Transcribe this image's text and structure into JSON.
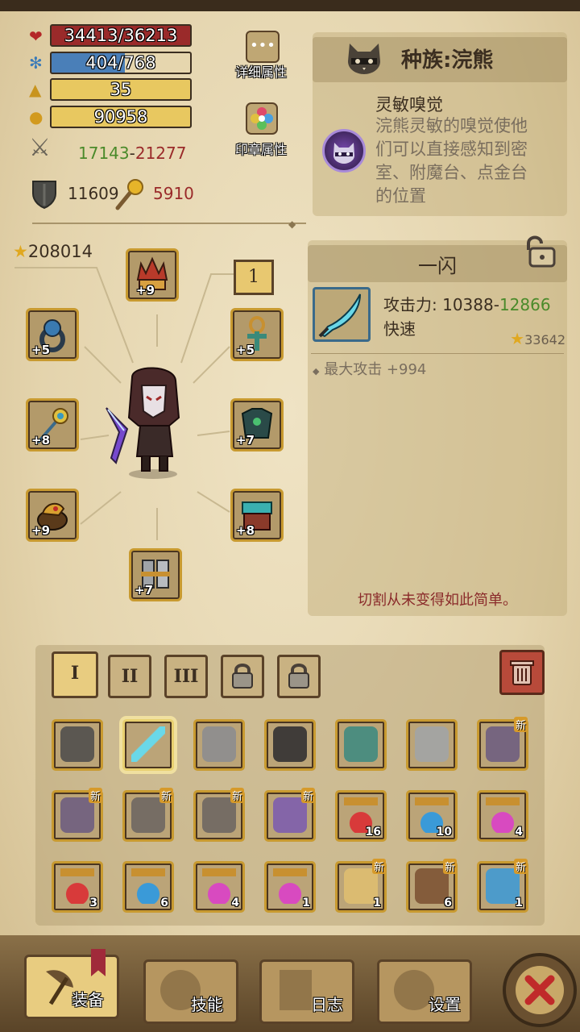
{
  "stats": {
    "hp": "34413/36213",
    "mp": "404/768",
    "level": "35",
    "gold": "90958",
    "attack_low": "17143",
    "attack_dash": "-",
    "attack_high": "21277",
    "defense": "11609",
    "magic": "5910"
  },
  "buttons": {
    "detail_attributes": "详细属性",
    "seal_attributes": "印章属性",
    "detail_icon": "•••"
  },
  "race": {
    "title": "种族:浣熊",
    "skill_name": "灵敏嗅觉",
    "skill_desc_lines": [
      "浣熊灵敏的嗅觉使他",
      "们可以直接感知到密",
      "室、附魔台、点金台",
      "的位置"
    ]
  },
  "score": "208014",
  "page_badge": "1",
  "equipment": {
    "levels": {
      "helmet": "+9",
      "ring": "+5",
      "amulet": "+5",
      "staff": "+8",
      "armor": "+7",
      "bracer": "+9",
      "belt": "+8",
      "boots": "+7"
    }
  },
  "item_detail": {
    "name": "一闪",
    "attack_label": "攻击力: 10388",
    "attack_dash": "-",
    "attack_high": "12866",
    "speed": "快速",
    "score": "33642",
    "bonus": "最大攻击 +994",
    "flavor": "切割从未变得如此简单。"
  },
  "tabs": [
    "I",
    "II",
    "III"
  ],
  "inventory": [
    [
      {
        "icon": "shovel-staff-icon"
      },
      {
        "icon": "blade-icon",
        "selected": true
      },
      {
        "icon": "shoulder-armor-icon"
      },
      {
        "icon": "dark-armor-icon"
      },
      {
        "icon": "teal-boots-icon"
      },
      {
        "icon": "steel-boots-icon"
      },
      {
        "icon": "purple-bracer-icon",
        "new": "新"
      }
    ],
    [
      {
        "icon": "purple-bracer-icon",
        "new": "新"
      },
      {
        "icon": "spider-helm-icon",
        "new": "新"
      },
      {
        "icon": "spider-helm-icon",
        "new": "新"
      },
      {
        "icon": "purple-glove-icon",
        "new": "新"
      },
      {
        "icon": "red-potion-icon",
        "count": "16"
      },
      {
        "icon": "blue-potion-icon",
        "count": "10"
      },
      {
        "icon": "pink-potion-icon",
        "count": "4"
      }
    ],
    [
      {
        "icon": "red-flask-icon",
        "count": "3"
      },
      {
        "icon": "blue-flask-icon",
        "count": "6"
      },
      {
        "icon": "pink-flask-icon",
        "count": "4"
      },
      {
        "icon": "rune-potion-icon",
        "count": "1"
      },
      {
        "icon": "scroll-icon",
        "count": "1",
        "new": "新"
      },
      {
        "icon": "pickaxe-icon",
        "count": "6",
        "new": "新"
      },
      {
        "icon": "eye-scroll-icon",
        "count": "1",
        "new": "新"
      }
    ]
  ],
  "nav": {
    "equip": "装备",
    "skills": "技能",
    "log": "日志",
    "settings": "设置"
  },
  "colors": {
    "hp": "#9a2a2a",
    "mp": "#4a7fb8",
    "level": "#e8c860",
    "gold": "#e8c860",
    "attack_low": "#4a8a2a",
    "attack_high": "#9a2a2a",
    "border": "#c89a30"
  }
}
